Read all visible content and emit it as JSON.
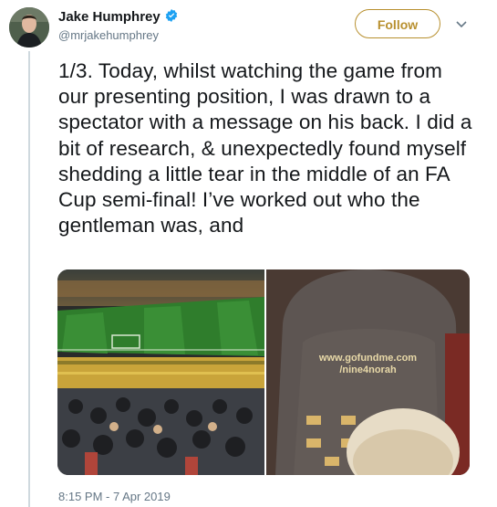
{
  "author": {
    "name": "Jake Humphrey",
    "handle": "@mrjakehumphrey",
    "verified": true
  },
  "follow_label": "Follow",
  "tweet_text": "1/3. Today, whilst watching the game from our presenting position, I was drawn to a spectator with a message on his back. I did a bit of research, & unexpectedly found myself shedding a little tear in the middle of an FA Cup semi-final! I’ve worked out who the gentleman was, and",
  "media": {
    "hoodie_text_line1": "www.gofundme.com",
    "hoodie_text_line2": "/nine4norah"
  },
  "timestamp": "8:15 PM - 7 Apr 2019",
  "colors": {
    "accent": "#b8902f",
    "verified": "#1da1f2",
    "text": "#14171a",
    "muted": "#657786"
  },
  "icons": [
    "verified-badge-icon",
    "chevron-down-icon"
  ]
}
